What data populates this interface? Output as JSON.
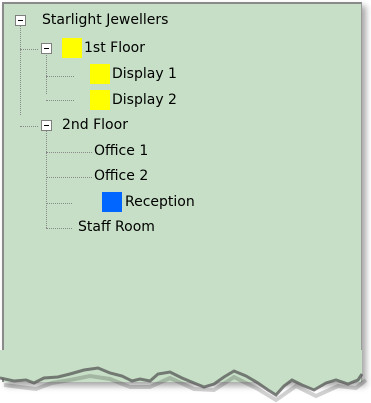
{
  "tree": {
    "root": {
      "label": "Starlight Jewellers"
    },
    "floor1": {
      "label": "1st Floor",
      "color": "#ffff00"
    },
    "display1": {
      "label": "Display 1",
      "color": "#ffff00"
    },
    "display2": {
      "label": "Display 2",
      "color": "#ffff00"
    },
    "floor2": {
      "label": "2nd Floor"
    },
    "office1": {
      "label": "Office 1"
    },
    "office2": {
      "label": "Office 2"
    },
    "reception": {
      "label": "Reception",
      "color": "#0066ff"
    },
    "staffroom": {
      "label": "Staff Room"
    }
  },
  "colors": {
    "background": "#c6dfc6"
  }
}
